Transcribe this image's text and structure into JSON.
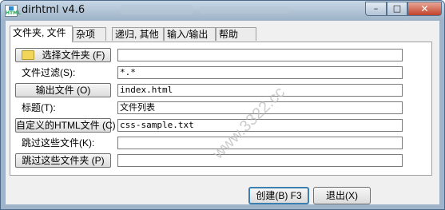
{
  "window": {
    "title": "dirhtml v4.6",
    "app_icon_text": "HTML"
  },
  "caption_buttons": {
    "minimize": "–",
    "maximize": "□",
    "close": "✕"
  },
  "tabs": [
    {
      "label": "文件夹, 文件",
      "active": true
    },
    {
      "label": "杂项",
      "active": false
    },
    {
      "label": "递归, 其他",
      "active": false
    },
    {
      "label": "输入/输出",
      "active": false
    },
    {
      "label": "帮助",
      "active": false
    }
  ],
  "form": {
    "select_folder": {
      "label": "选择文件夹 (F)",
      "value": ""
    },
    "file_filter": {
      "label": "文件过滤(S):",
      "value": "*.*"
    },
    "output_file": {
      "label": "输出文件 (O)",
      "value": "index.html"
    },
    "title": {
      "label": "标题(T):",
      "value": "文件列表"
    },
    "custom_html": {
      "label": "自定义的HTML文件 (C)",
      "value": "css-sample.txt"
    },
    "skip_files": {
      "label": "跳过这些文件(K):",
      "value": ""
    },
    "skip_folders": {
      "label": "跳过这些文件夹 (P)",
      "value": ""
    }
  },
  "buttons": {
    "create": "创建(B) F3",
    "exit": "退出(X)"
  },
  "watermark": {
    "text": "www.3322.cc"
  },
  "icons": {
    "folder": "folder-icon",
    "app": "app-icon"
  }
}
